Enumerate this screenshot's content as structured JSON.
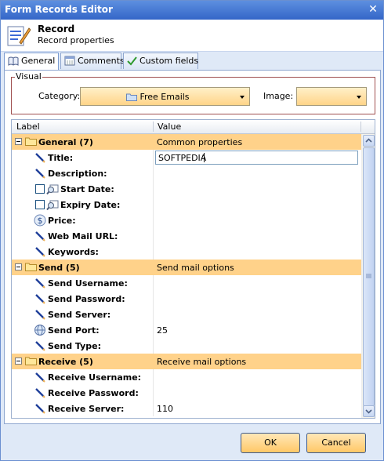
{
  "window": {
    "title": "Form Records Editor",
    "close_glyph": "✕"
  },
  "header": {
    "title": "Record",
    "subtitle": "Record properties"
  },
  "tabs": [
    {
      "label": "General",
      "icon": "book-icon"
    },
    {
      "label": "Comments",
      "icon": "calendar-icon"
    },
    {
      "label": "Custom fields",
      "icon": "checkmark-icon"
    }
  ],
  "visual": {
    "legend": "Visual",
    "category_label": "Category:",
    "category_value": "Free Emails",
    "image_label": "Image:",
    "image_value": ""
  },
  "grid": {
    "col_label": "Label",
    "col_value": "Value",
    "rows": [
      {
        "type": "category",
        "label": "General (7)",
        "value": "Common properties"
      },
      {
        "type": "prop",
        "icon": "pencil-icon",
        "label": "Title:",
        "value": "SOFTPEDIA",
        "editing": true
      },
      {
        "type": "prop",
        "icon": "pencil-icon",
        "label": "Description:",
        "value": ""
      },
      {
        "type": "prop",
        "icon": "calendar-search-icon",
        "checkbox": true,
        "label": "Start Date:",
        "value": ""
      },
      {
        "type": "prop",
        "icon": "calendar-search-icon",
        "checkbox": true,
        "label": "Expiry Date:",
        "value": ""
      },
      {
        "type": "prop",
        "icon": "dollar-icon",
        "label": "Price:",
        "value": ""
      },
      {
        "type": "prop",
        "icon": "pencil-icon",
        "label": "Web Mail URL:",
        "value": ""
      },
      {
        "type": "prop",
        "icon": "pencil-icon",
        "label": "Keywords:",
        "value": ""
      },
      {
        "type": "category",
        "label": "Send (5)",
        "value": "Send mail options"
      },
      {
        "type": "prop",
        "icon": "pencil-icon",
        "label": "Send Username:",
        "value": ""
      },
      {
        "type": "prop",
        "icon": "pencil-icon",
        "label": "Send Password:",
        "value": ""
      },
      {
        "type": "prop",
        "icon": "pencil-icon",
        "label": "Send Server:",
        "value": ""
      },
      {
        "type": "prop",
        "icon": "globe-icon",
        "label": "Send Port:",
        "value": "25"
      },
      {
        "type": "prop",
        "icon": "pencil-icon",
        "label": "Send Type:",
        "value": ""
      },
      {
        "type": "category",
        "label": "Receive (5)",
        "value": "Receive mail options"
      },
      {
        "type": "prop",
        "icon": "pencil-icon",
        "label": "Receive Username:",
        "value": ""
      },
      {
        "type": "prop",
        "icon": "pencil-icon",
        "label": "Receive Password:",
        "value": ""
      },
      {
        "type": "prop",
        "icon": "pencil-icon",
        "label": "Receive Server:",
        "value": "110"
      }
    ]
  },
  "buttons": {
    "ok": "OK",
    "cancel": "Cancel"
  }
}
